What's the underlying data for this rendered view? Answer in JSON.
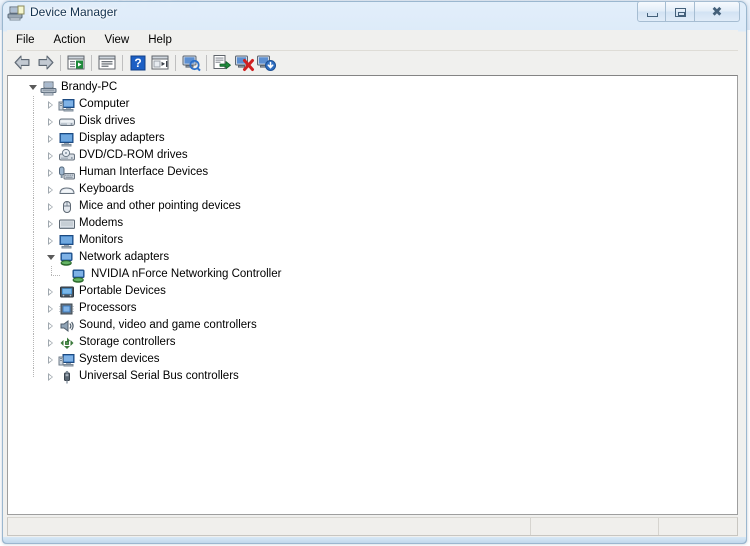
{
  "window": {
    "title": "Device Manager",
    "title_icon": "device-manager-icon",
    "background_hint": "blurred desktop text behind aero glass titlebar",
    "controls": [
      {
        "name": "minimize",
        "glyph": "minimize-icon"
      },
      {
        "name": "maximize",
        "glyph": "restore-icon"
      },
      {
        "name": "close",
        "glyph": "close-icon"
      }
    ]
  },
  "menubar": {
    "items": [
      {
        "label": "File"
      },
      {
        "label": "Action"
      },
      {
        "label": "View"
      },
      {
        "label": "Help"
      }
    ]
  },
  "toolbar": {
    "buttons": [
      {
        "name": "back-button",
        "icon": "back-arrow-icon"
      },
      {
        "name": "forward-button",
        "icon": "forward-arrow-icon"
      },
      {
        "name": "separator-1",
        "icon": "separator"
      },
      {
        "name": "show-hide-console-tree-button",
        "icon": "console-tree-icon"
      },
      {
        "name": "separator-2",
        "icon": "separator"
      },
      {
        "name": "properties-button",
        "icon": "properties-icon"
      },
      {
        "name": "separator-3",
        "icon": "separator"
      },
      {
        "name": "help-button",
        "icon": "help-question-icon"
      },
      {
        "name": "view-button",
        "icon": "view-list-icon"
      },
      {
        "name": "separator-4",
        "icon": "separator"
      },
      {
        "name": "scan-for-hardware-changes-button",
        "icon": "scan-hardware-icon"
      },
      {
        "name": "separator-5",
        "icon": "separator"
      },
      {
        "name": "update-driver-button",
        "icon": "update-driver-icon"
      },
      {
        "name": "uninstall-device-button",
        "icon": "uninstall-device-icon"
      },
      {
        "name": "disable-device-button",
        "icon": "disable-device-icon"
      }
    ]
  },
  "tree": {
    "root": {
      "label": "Brandy-PC",
      "icon": "computer-root-icon",
      "expanded": true
    },
    "nodes": [
      {
        "label": "Computer",
        "icon": "computer-icon",
        "expanded": false,
        "level": 1
      },
      {
        "label": "Disk drives",
        "icon": "disk-drive-icon",
        "expanded": false,
        "level": 1
      },
      {
        "label": "Display adapters",
        "icon": "display-adapter-icon",
        "expanded": false,
        "level": 1
      },
      {
        "label": "DVD/CD-ROM drives",
        "icon": "dvd-drive-icon",
        "expanded": false,
        "level": 1
      },
      {
        "label": "Human Interface Devices",
        "icon": "hid-icon",
        "expanded": false,
        "level": 1
      },
      {
        "label": "Keyboards",
        "icon": "keyboard-icon",
        "expanded": false,
        "level": 1
      },
      {
        "label": "Mice and other pointing devices",
        "icon": "mouse-icon",
        "expanded": false,
        "level": 1
      },
      {
        "label": "Modems",
        "icon": "modem-icon",
        "expanded": false,
        "level": 1
      },
      {
        "label": "Monitors",
        "icon": "monitor-icon",
        "expanded": false,
        "level": 1
      },
      {
        "label": "Network adapters",
        "icon": "network-adapter-icon",
        "expanded": true,
        "level": 1
      },
      {
        "label": "NVIDIA nForce Networking Controller",
        "icon": "network-adapter-icon",
        "expanded": null,
        "level": 2
      },
      {
        "label": "Portable Devices",
        "icon": "portable-device-icon",
        "expanded": false,
        "level": 1
      },
      {
        "label": "Processors",
        "icon": "processor-icon",
        "expanded": false,
        "level": 1
      },
      {
        "label": "Sound, video and game controllers",
        "icon": "sound-controller-icon",
        "expanded": false,
        "level": 1
      },
      {
        "label": "Storage controllers",
        "icon": "storage-controller-icon",
        "expanded": false,
        "level": 1
      },
      {
        "label": "System devices",
        "icon": "system-device-icon",
        "expanded": false,
        "level": 1
      },
      {
        "label": "Universal Serial Bus controllers",
        "icon": "usb-controller-icon",
        "expanded": false,
        "level": 1
      }
    ]
  },
  "statusbar": {
    "segments": [
      {
        "text": ""
      },
      {
        "text": ""
      },
      {
        "text": ""
      }
    ]
  },
  "colors": {
    "glass": "#dfeaf8",
    "chrome": "#f0f0ee",
    "client_bg": "#ffffff",
    "text": "#000000",
    "title_text": "#12314f",
    "tree_line": "#b5b5b5",
    "accent_blue": "#2a5faa"
  }
}
